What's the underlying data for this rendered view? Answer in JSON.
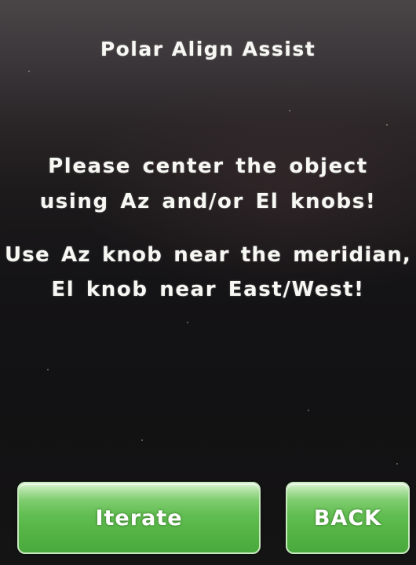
{
  "screen": {
    "title": "Polar Align Assist",
    "message1": {
      "line1": "Please center the object",
      "line2": "using Az and/or El knobs!"
    },
    "message2": {
      "line1": "Use Az knob near the meridian,",
      "line2": "El knob near East/West!"
    }
  },
  "buttons": {
    "iterate_label": "Iterate",
    "back_label": "BACK"
  },
  "colors": {
    "text": "#f7f7f3",
    "button_green": "#5fbb4f",
    "background": "#141315"
  }
}
